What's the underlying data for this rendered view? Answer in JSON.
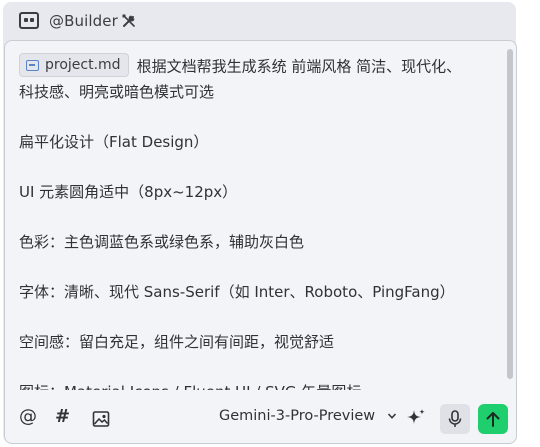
{
  "header": {
    "title": "@Builder",
    "agent_icon": "agent-bot-icon",
    "tools_icon": "wrench-screwdriver-icon"
  },
  "editor": {
    "attachment": {
      "label": "project.md",
      "icon": "file-image-icon"
    },
    "intro_line1": "根据文档帮我生成系统 前端风格 简洁、现代化、",
    "intro_line2": "科技感、明亮或暗色模式可选",
    "paragraphs": [
      "扁平化设计（Flat Design）",
      "UI 元素圆角适中（8px~12px）",
      "色彩：主色调蓝色系或绿色系，辅助灰白色",
      "字体：清晰、现代 Sans-Serif（如 Inter、Roboto、PingFang）",
      "空间感：留白充足，组件之间有间距，视觉舒适",
      "图标：Material Icons / Fluent UI / SVG 矢量图标"
    ]
  },
  "footer": {
    "mention_symbol": "@",
    "hash_symbol": "#",
    "model_name": "Gemini-3-Pro-Preview",
    "icons": [
      "image-icon",
      "chevron-down-icon",
      "sparkle-icon",
      "microphone-icon",
      "arrow-up-icon"
    ]
  },
  "colors": {
    "panel": "#e7e9ee",
    "editor": "#f3f4f7",
    "send_button": "#1fcf6e",
    "text": "#2f3237"
  }
}
